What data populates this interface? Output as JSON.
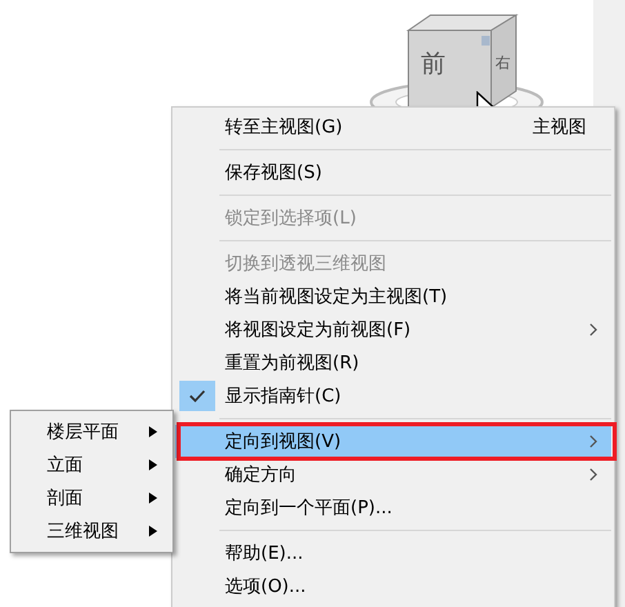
{
  "viewcube": {
    "front": "前",
    "right": "右"
  },
  "context_menu": {
    "items": [
      {
        "kind": "item",
        "label": "转至主视图(G)",
        "shortcut": "主视图",
        "disabled": false,
        "checked": false,
        "selected": false,
        "submenu": false,
        "outlined": false
      },
      {
        "kind": "separator"
      },
      {
        "kind": "item",
        "label": "保存视图(S)",
        "disabled": false,
        "checked": false,
        "selected": false,
        "submenu": false,
        "outlined": false
      },
      {
        "kind": "separator"
      },
      {
        "kind": "item",
        "label": "锁定到选择项(L)",
        "disabled": true,
        "checked": false,
        "selected": false,
        "submenu": false,
        "outlined": false
      },
      {
        "kind": "separator"
      },
      {
        "kind": "item",
        "label": "切换到透视三维视图",
        "disabled": true,
        "checked": false,
        "selected": false,
        "submenu": false,
        "outlined": false
      },
      {
        "kind": "item",
        "label": "将当前视图设定为主视图(T)",
        "disabled": false,
        "checked": false,
        "selected": false,
        "submenu": false,
        "outlined": false
      },
      {
        "kind": "item",
        "label": "将视图设定为前视图(F)",
        "disabled": false,
        "checked": false,
        "selected": false,
        "submenu": true,
        "outlined": false
      },
      {
        "kind": "item",
        "label": "重置为前视图(R)",
        "disabled": false,
        "checked": false,
        "selected": false,
        "submenu": false,
        "outlined": false
      },
      {
        "kind": "item",
        "label": "显示指南针(C)",
        "disabled": false,
        "checked": true,
        "selected": false,
        "submenu": false,
        "outlined": false
      },
      {
        "kind": "separator"
      },
      {
        "kind": "item",
        "label": "定向到视图(V)",
        "disabled": false,
        "checked": false,
        "selected": true,
        "submenu": true,
        "outlined": true
      },
      {
        "kind": "item",
        "label": "确定方向",
        "disabled": false,
        "checked": false,
        "selected": false,
        "submenu": true,
        "outlined": false
      },
      {
        "kind": "item",
        "label": "定向到一个平面(P)...",
        "disabled": false,
        "checked": false,
        "selected": false,
        "submenu": false,
        "outlined": false
      },
      {
        "kind": "separator"
      },
      {
        "kind": "item",
        "label": "帮助(E)...",
        "disabled": false,
        "checked": false,
        "selected": false,
        "submenu": false,
        "outlined": false
      },
      {
        "kind": "item",
        "label": "选项(O)...",
        "disabled": false,
        "checked": false,
        "selected": false,
        "submenu": false,
        "outlined": false
      }
    ]
  },
  "submenu": {
    "items": [
      {
        "label": "楼层平面",
        "submenu": true
      },
      {
        "label": "立面",
        "submenu": true
      },
      {
        "label": "剖面",
        "submenu": true
      },
      {
        "label": "三维视图",
        "submenu": true
      }
    ]
  }
}
